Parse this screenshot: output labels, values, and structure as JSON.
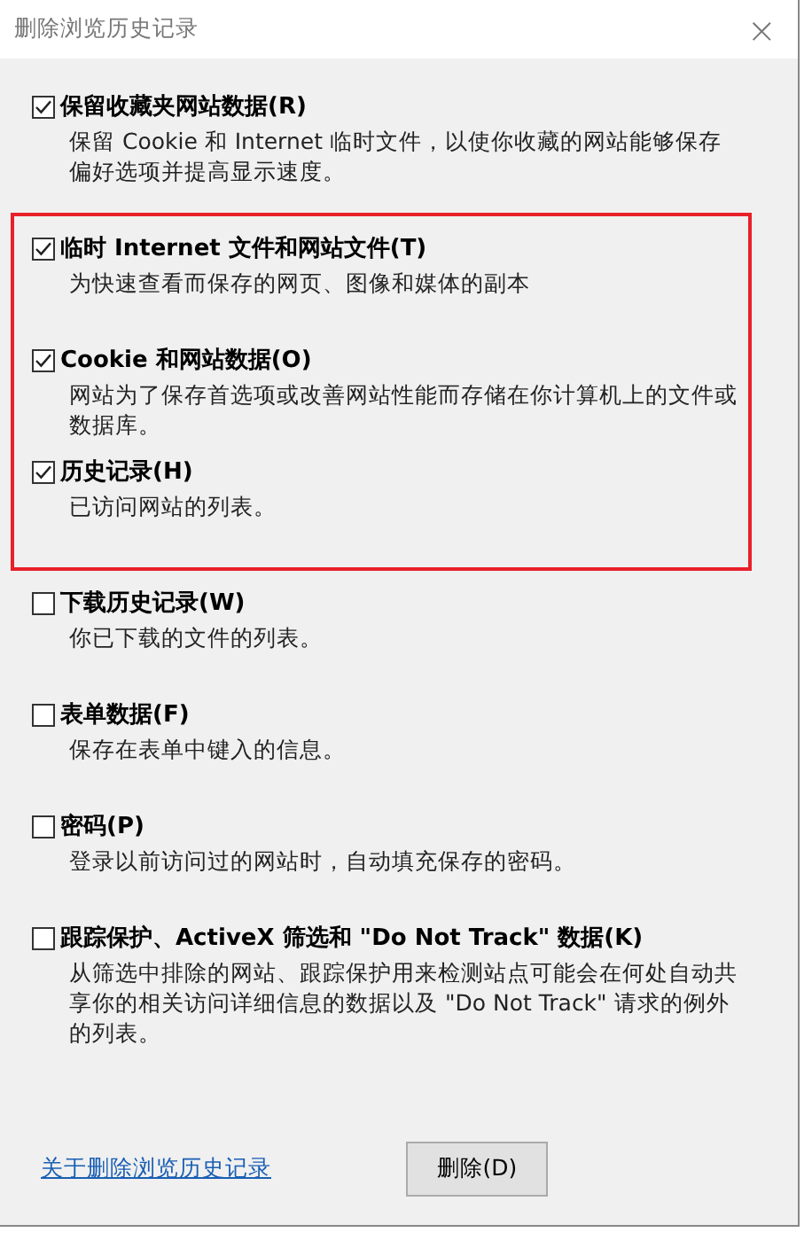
{
  "window": {
    "title": "删除浏览历史记录",
    "close": "×"
  },
  "sections": [
    {
      "highlighted": false,
      "options": [
        {
          "label": "保留收藏夹网站数据(R)",
          "checked": true,
          "description": "保留 Cookie 和 Internet 临时文件，以使你收藏的网站能够保存偏好选项并提高显示速度。"
        }
      ]
    },
    {
      "highlighted": true,
      "options": [
        {
          "label": "临时 Internet 文件和网站文件(T)",
          "checked": true,
          "description": "为快速查看而保存的网页、图像和媒体的副本"
        },
        {
          "label": "Cookie 和网站数据(O)",
          "checked": true,
          "description": "网站为了保存首选项或改善网站性能而存储在你计算机上的文件或数据库。"
        },
        {
          "label": "历史记录(H)",
          "checked": true,
          "description": "已访问网站的列表。"
        }
      ]
    },
    {
      "highlighted": false,
      "options": [
        {
          "label": "下载历史记录(W)",
          "checked": false,
          "description": "你已下载的文件的列表。"
        },
        {
          "label": "表单数据(F)",
          "checked": false,
          "description": "保存在表单中键入的信息。"
        },
        {
          "label": "密码(P)",
          "checked": false,
          "description": "登录以前访问过的网站时，自动填充保存的密码。"
        },
        {
          "label": "跟踪保护、ActiveX 筛选和 \"Do Not Track\" 数据(K)",
          "checked": false,
          "description": "从筛选中排除的网站、跟踪保护用来检测站点可能会在何处自动共享你的相关访问详细信息的数据以及 \"Do Not Track\" 请求的例外的列表。"
        }
      ]
    }
  ],
  "footer": {
    "link": "关于删除浏览历史记录",
    "button": "删除(D)"
  }
}
